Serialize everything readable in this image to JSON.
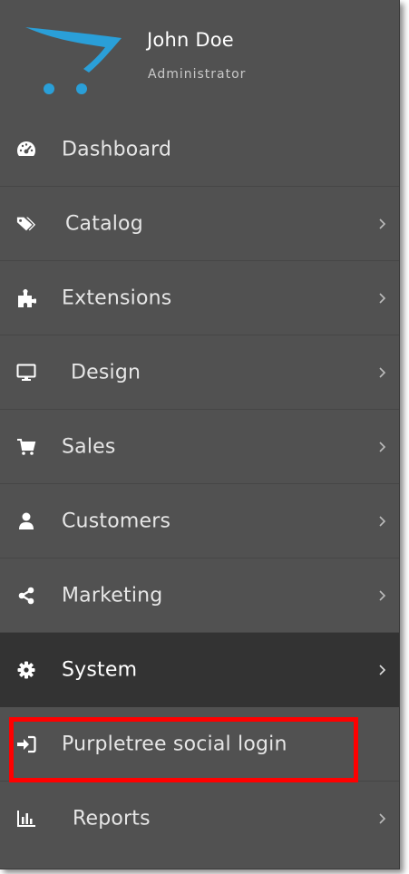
{
  "profile": {
    "name": "John Doe",
    "role": "Administrator",
    "logo_color": "#2a9fd8"
  },
  "menu": {
    "items": [
      {
        "label": "Dashboard",
        "icon": "dashboard-icon",
        "has_submenu": false
      },
      {
        "label": "Catalog",
        "icon": "tags-icon",
        "has_submenu": true
      },
      {
        "label": "Extensions",
        "icon": "puzzle-icon",
        "has_submenu": true
      },
      {
        "label": "Design",
        "icon": "monitor-icon",
        "has_submenu": true
      },
      {
        "label": "Sales",
        "icon": "cart-icon",
        "has_submenu": true
      },
      {
        "label": "Customers",
        "icon": "user-icon",
        "has_submenu": true
      },
      {
        "label": "Marketing",
        "icon": "share-icon",
        "has_submenu": true
      },
      {
        "label": "System",
        "icon": "gear-icon",
        "has_submenu": true,
        "active": true
      },
      {
        "label": "Purpletree social login",
        "icon": "sign-in-icon",
        "has_submenu": false,
        "highlighted": true
      },
      {
        "label": "Reports",
        "icon": "bar-chart-icon",
        "has_submenu": true
      }
    ]
  },
  "colors": {
    "sidebar_bg": "#515151",
    "active_bg": "#333333",
    "highlight_border": "#ff0000"
  }
}
